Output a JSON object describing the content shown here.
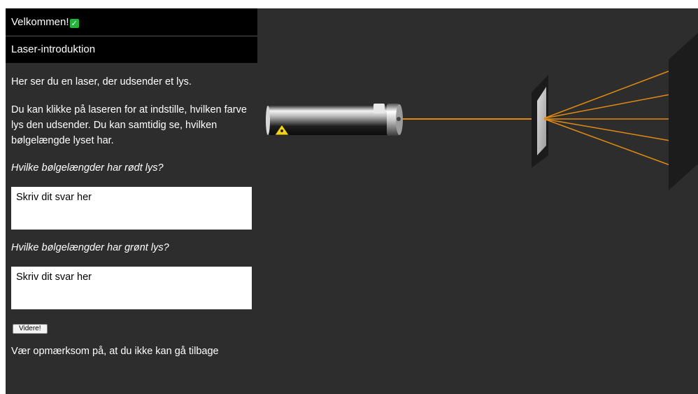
{
  "sidebar": {
    "welcome_title": "Velkommen!",
    "welcome_check_icon": "check-mark-icon",
    "section_title": "Laser-introduktion",
    "intro_text": "Her ser du en laser, der udsender et lys.",
    "instruction_text": "Du kan klikke på laseren for at indstille, hvilken farve lys den udsender. Du kan samtidig se, hvilken bølgelængde lyset har.",
    "question1": "Hvilke bølgelængder har rødt lys?",
    "answer1_placeholder": "Skriv dit svar her",
    "question2": "Hvilke bølgelængder har grønt lys?",
    "answer2_placeholder": "Skriv dit svar her",
    "next_button_label": "Videre!",
    "warning_text": "Vær opmærksom på, at du ikke kan gå tilbage"
  },
  "colors": {
    "background": "#2d2d2d",
    "header": "#000000",
    "laser_beam": "#e08a12",
    "check_green": "#21b53a"
  },
  "simulation": {
    "icons": [
      "laser-warning-icon"
    ]
  }
}
